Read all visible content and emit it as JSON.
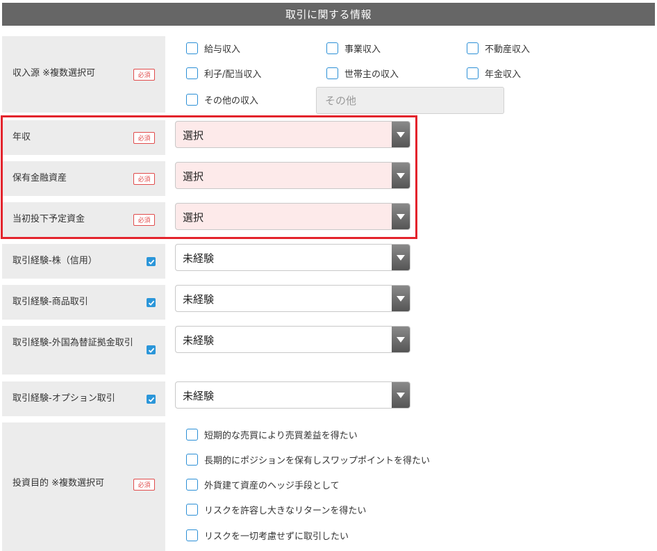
{
  "header": {
    "title": "取引に関する情報"
  },
  "badge_required": "必須",
  "income_source": {
    "label": "収入源 ※複数選択可",
    "options": [
      "給与収入",
      "事業収入",
      "不動産収入",
      "利子/配当収入",
      "世帯主の収入",
      "年金収入",
      "その他の収入"
    ],
    "other_placeholder": "その他"
  },
  "annual_income": {
    "label": "年収",
    "value": "選択"
  },
  "financial_assets": {
    "label": "保有金融資産",
    "value": "選択"
  },
  "initial_funds": {
    "label": "当初投下予定資金",
    "value": "選択"
  },
  "exp_stock_margin": {
    "label": "取引経験-株（信用）",
    "value": "未経験"
  },
  "exp_commodity": {
    "label": "取引経験-商品取引",
    "value": "未経験"
  },
  "exp_fx_margin": {
    "label": "取引経験-外国為替証拠金取引",
    "value": "未経験"
  },
  "exp_options": {
    "label": "取引経験-オプション取引",
    "value": "未経験"
  },
  "investment_purpose": {
    "label": "投資目的 ※複数選択可",
    "options": [
      "短期的な売買により売買差益を得たい",
      "長期的にポジションを保有しスワップポイントを得たい",
      "外貨建て資産のヘッジ手段として",
      "リスクを許容し大きなリターンを得たい",
      "リスクを一切考慮せずに取引したい"
    ]
  },
  "colors": {
    "accent_blue": "#2b96d9",
    "required_red": "#e14c4c",
    "highlight_red": "#e3232c",
    "header_gray": "#666666"
  }
}
